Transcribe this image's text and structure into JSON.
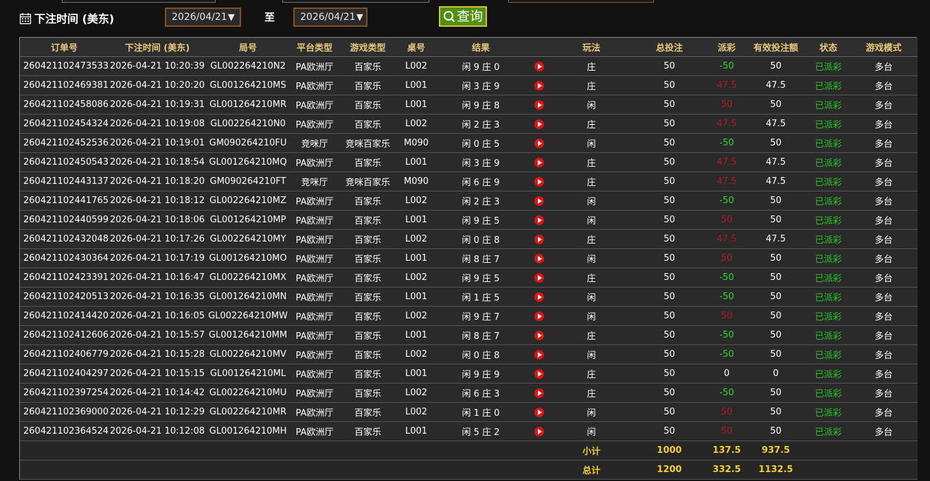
{
  "filter": {
    "label": "下注时间 (美东)",
    "start_date": "2026/04/21",
    "to_label": "至",
    "end_date": "2026/04/21",
    "query_label": "查询"
  },
  "table": {
    "headers": [
      "订单号",
      "下注时间 (美东)",
      "局号",
      "平台类型",
      "游戏类型",
      "桌号",
      "结果",
      "",
      "玩法",
      "总投注",
      "派彩",
      "有效投注额",
      "状态",
      "游戏模式"
    ],
    "rows": [
      {
        "order": "260421102473533",
        "time": "2026-04-21 10:20:39",
        "round": "GL002264210N2",
        "platform": "PA欧洲厅",
        "game": "百家乐",
        "table": "L002",
        "result": "闲 9 庄 0",
        "play": "庄",
        "bet": "50",
        "payout": "-50",
        "payout_color": "green",
        "valid": "50",
        "status": "已派彩",
        "mode": "多台"
      },
      {
        "order": "260421102469381",
        "time": "2026-04-21 10:20:20",
        "round": "GL001264210MS",
        "platform": "PA欧洲厅",
        "game": "百家乐",
        "table": "L001",
        "result": "闲 3 庄 9",
        "play": "庄",
        "bet": "50",
        "payout": "47.5",
        "payout_color": "red",
        "valid": "47.5",
        "status": "已派彩",
        "mode": "多台"
      },
      {
        "order": "260421102458086",
        "time": "2026-04-21 10:19:31",
        "round": "GL001264210MR",
        "platform": "PA欧洲厅",
        "game": "百家乐",
        "table": "L001",
        "result": "闲 9 庄 8",
        "play": "闲",
        "bet": "50",
        "payout": "50",
        "payout_color": "red",
        "valid": "50",
        "status": "已派彩",
        "mode": "多台"
      },
      {
        "order": "260421102454324",
        "time": "2026-04-21 10:19:08",
        "round": "GL002264210N0",
        "platform": "PA欧洲厅",
        "game": "百家乐",
        "table": "L002",
        "result": "闲 2 庄 3",
        "play": "庄",
        "bet": "50",
        "payout": "47.5",
        "payout_color": "red",
        "valid": "47.5",
        "status": "已派彩",
        "mode": "多台"
      },
      {
        "order": "260421102452536",
        "time": "2026-04-21 10:19:01",
        "round": "GM090264210FU",
        "platform": "竞咪厅",
        "game": "竞咪百家乐",
        "table": "M090",
        "result": "闲 0 庄 5",
        "play": "闲",
        "bet": "50",
        "payout": "-50",
        "payout_color": "green",
        "valid": "50",
        "status": "已派彩",
        "mode": "多台"
      },
      {
        "order": "260421102450543",
        "time": "2026-04-21 10:18:54",
        "round": "GL001264210MQ",
        "platform": "PA欧洲厅",
        "game": "百家乐",
        "table": "L001",
        "result": "闲 3 庄 9",
        "play": "庄",
        "bet": "50",
        "payout": "47.5",
        "payout_color": "red",
        "valid": "47.5",
        "status": "已派彩",
        "mode": "多台"
      },
      {
        "order": "260421102443137",
        "time": "2026-04-21 10:18:20",
        "round": "GM090264210FT",
        "platform": "竞咪厅",
        "game": "竞咪百家乐",
        "table": "M090",
        "result": "闲 6 庄 9",
        "play": "庄",
        "bet": "50",
        "payout": "47.5",
        "payout_color": "red",
        "valid": "47.5",
        "status": "已派彩",
        "mode": "多台"
      },
      {
        "order": "260421102441765",
        "time": "2026-04-21 10:18:12",
        "round": "GL002264210MZ",
        "platform": "PA欧洲厅",
        "game": "百家乐",
        "table": "L002",
        "result": "闲 2 庄 3",
        "play": "闲",
        "bet": "50",
        "payout": "-50",
        "payout_color": "green",
        "valid": "50",
        "status": "已派彩",
        "mode": "多台"
      },
      {
        "order": "260421102440599",
        "time": "2026-04-21 10:18:06",
        "round": "GL001264210MP",
        "platform": "PA欧洲厅",
        "game": "百家乐",
        "table": "L001",
        "result": "闲 9 庄 5",
        "play": "闲",
        "bet": "50",
        "payout": "50",
        "payout_color": "red",
        "valid": "50",
        "status": "已派彩",
        "mode": "多台"
      },
      {
        "order": "260421102432048",
        "time": "2026-04-21 10:17:26",
        "round": "GL002264210MY",
        "platform": "PA欧洲厅",
        "game": "百家乐",
        "table": "L002",
        "result": "闲 0 庄 8",
        "play": "庄",
        "bet": "50",
        "payout": "47.5",
        "payout_color": "red",
        "valid": "47.5",
        "status": "已派彩",
        "mode": "多台"
      },
      {
        "order": "260421102430364",
        "time": "2026-04-21 10:17:19",
        "round": "GL001264210MO",
        "platform": "PA欧洲厅",
        "game": "百家乐",
        "table": "L001",
        "result": "闲 8 庄 7",
        "play": "闲",
        "bet": "50",
        "payout": "50",
        "payout_color": "red",
        "valid": "50",
        "status": "已派彩",
        "mode": "多台"
      },
      {
        "order": "260421102423391",
        "time": "2026-04-21 10:16:47",
        "round": "GL002264210MX",
        "platform": "PA欧洲厅",
        "game": "百家乐",
        "table": "L002",
        "result": "闲 9 庄 5",
        "play": "庄",
        "bet": "50",
        "payout": "-50",
        "payout_color": "green",
        "valid": "50",
        "status": "已派彩",
        "mode": "多台"
      },
      {
        "order": "260421102420513",
        "time": "2026-04-21 10:16:35",
        "round": "GL001264210MN",
        "platform": "PA欧洲厅",
        "game": "百家乐",
        "table": "L001",
        "result": "闲 1 庄 5",
        "play": "闲",
        "bet": "50",
        "payout": "-50",
        "payout_color": "green",
        "valid": "50",
        "status": "已派彩",
        "mode": "多台"
      },
      {
        "order": "260421102414420",
        "time": "2026-04-21 10:16:05",
        "round": "GL002264210MW",
        "platform": "PA欧洲厅",
        "game": "百家乐",
        "table": "L002",
        "result": "闲 9 庄 7",
        "play": "闲",
        "bet": "50",
        "payout": "50",
        "payout_color": "red",
        "valid": "50",
        "status": "已派彩",
        "mode": "多台"
      },
      {
        "order": "260421102412606",
        "time": "2026-04-21 10:15:57",
        "round": "GL001264210MM",
        "platform": "PA欧洲厅",
        "game": "百家乐",
        "table": "L001",
        "result": "闲 8 庄 7",
        "play": "庄",
        "bet": "50",
        "payout": "-50",
        "payout_color": "green",
        "valid": "50",
        "status": "已派彩",
        "mode": "多台"
      },
      {
        "order": "260421102406779",
        "time": "2026-04-21 10:15:28",
        "round": "GL002264210MV",
        "platform": "PA欧洲厅",
        "game": "百家乐",
        "table": "L002",
        "result": "闲 0 庄 8",
        "play": "闲",
        "bet": "50",
        "payout": "-50",
        "payout_color": "green",
        "valid": "50",
        "status": "已派彩",
        "mode": "多台"
      },
      {
        "order": "260421102404297",
        "time": "2026-04-21 10:15:15",
        "round": "GL001264210ML",
        "platform": "PA欧洲厅",
        "game": "百家乐",
        "table": "L001",
        "result": "闲 9 庄 9",
        "play": "庄",
        "bet": "50",
        "payout": "0",
        "payout_color": "white",
        "valid": "0",
        "status": "已派彩",
        "mode": "多台"
      },
      {
        "order": "260421102397254",
        "time": "2026-04-21 10:14:42",
        "round": "GL002264210MU",
        "platform": "PA欧洲厅",
        "game": "百家乐",
        "table": "L002",
        "result": "闲 6 庄 3",
        "play": "庄",
        "bet": "50",
        "payout": "-50",
        "payout_color": "green",
        "valid": "50",
        "status": "已派彩",
        "mode": "多台"
      },
      {
        "order": "260421102369000",
        "time": "2026-04-21 10:12:29",
        "round": "GL002264210MR",
        "platform": "PA欧洲厅",
        "game": "百家乐",
        "table": "L002",
        "result": "闲 1 庄 0",
        "play": "闲",
        "bet": "50",
        "payout": "50",
        "payout_color": "red",
        "valid": "50",
        "status": "已派彩",
        "mode": "多台"
      },
      {
        "order": "260421102364524",
        "time": "2026-04-21 10:12:08",
        "round": "GL001264210MH",
        "platform": "PA欧洲厅",
        "game": "百家乐",
        "table": "L001",
        "result": "闲 5 庄 2",
        "play": "闲",
        "bet": "50",
        "payout": "50",
        "payout_color": "red",
        "valid": "50",
        "status": "已派彩",
        "mode": "多台"
      }
    ],
    "subtotal": {
      "label": "小计",
      "bet": "1000",
      "payout": "137.5",
      "valid": "937.5"
    },
    "total": {
      "label": "总计",
      "bet": "1200",
      "payout": "332.5",
      "valid": "1132.5"
    }
  },
  "icons": {
    "calendar": "calendar-icon",
    "search": "search-icon",
    "play": "play-icon"
  },
  "colors": {
    "header_text": "#e8c87a",
    "win": "#33d633",
    "loss": "#b01c1c",
    "status": "#22c622",
    "summary": "#f0d030",
    "query_button": "#4f8f14",
    "date_border": "#8a4e1f"
  }
}
